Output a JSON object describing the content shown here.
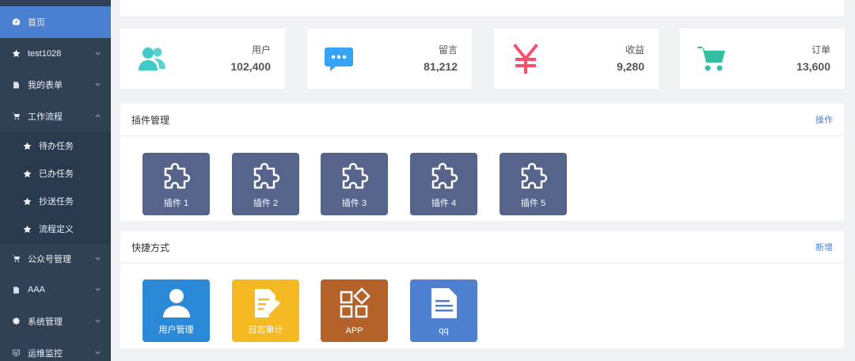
{
  "sidebar": {
    "items": [
      {
        "label": "首页",
        "icon": "dashboard-icon",
        "active": true
      },
      {
        "label": "test1028",
        "icon": "star-icon"
      },
      {
        "label": "我的表单",
        "icon": "form-icon"
      },
      {
        "label": "工作流程",
        "icon": "cart-icon",
        "expanded": true
      },
      {
        "label": "待办任务",
        "icon": "star-icon",
        "sub": true
      },
      {
        "label": "已办任务",
        "icon": "star-icon",
        "sub": true
      },
      {
        "label": "抄送任务",
        "icon": "star-icon",
        "sub": true
      },
      {
        "label": "流程定义",
        "icon": "star-icon",
        "sub": true
      },
      {
        "label": "公众号管理",
        "icon": "cart-icon"
      },
      {
        "label": "AAA",
        "icon": "form-icon"
      },
      {
        "label": "系统管理",
        "icon": "gear-icon"
      },
      {
        "label": "运维监控",
        "icon": "monitor-icon"
      }
    ]
  },
  "stats": [
    {
      "label": "用户",
      "value": "102,400",
      "icon": "users-icon",
      "color": "#40c9c6"
    },
    {
      "label": "留言",
      "value": "81,212",
      "icon": "message-icon",
      "color": "#36a3f7"
    },
    {
      "label": "收益",
      "value": "9,280",
      "icon": "yen-icon",
      "color": "#f4516c"
    },
    {
      "label": "订单",
      "value": "13,600",
      "icon": "shopping-cart-icon",
      "color": "#34bfa3"
    }
  ],
  "plugins": {
    "title": "插件管理",
    "action": "操作",
    "tile_color": "#56648c",
    "items": [
      {
        "label": "插件 1"
      },
      {
        "label": "插件 2"
      },
      {
        "label": "插件 3"
      },
      {
        "label": "插件 4"
      },
      {
        "label": "插件 5"
      }
    ]
  },
  "shortcuts": {
    "title": "快捷方式",
    "action": "新增",
    "items": [
      {
        "label": "用户管理",
        "icon": "user-icon",
        "color": "#2b8ad8"
      },
      {
        "label": "日志审计",
        "icon": "log-edit-icon",
        "color": "#f5b924"
      },
      {
        "label": "APP",
        "icon": "apps-icon",
        "color": "#b5622a"
      },
      {
        "label": "qq",
        "icon": "document-icon",
        "color": "#4f7fcf"
      }
    ]
  }
}
